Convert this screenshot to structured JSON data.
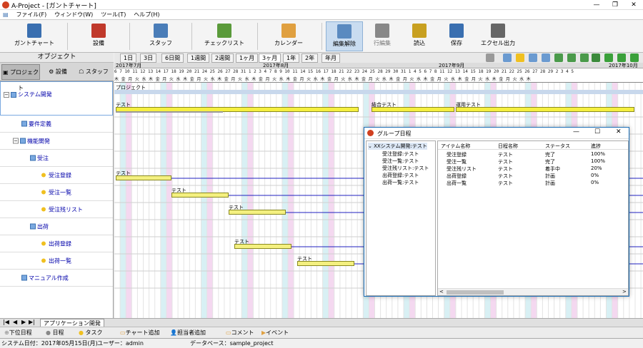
{
  "window": {
    "title": "A-Project - [ガントチャート]"
  },
  "menu": [
    "ファイル(F)",
    "ウィンドウ(W)",
    "ツール(T)",
    "ヘルプ(H)"
  ],
  "toolbar": [
    {
      "label": "ガントチャート",
      "icon": "gantt-icon",
      "color": "#3a6fb0"
    },
    {
      "label": "設備",
      "icon": "factory-icon",
      "color": "#c0392b"
    },
    {
      "label": "スタッフ",
      "icon": "staff-icon",
      "color": "#4a7db8"
    },
    {
      "label": "チェックリスト",
      "icon": "checklist-icon",
      "color": "#5a9a3a"
    },
    {
      "label": "カレンダー",
      "icon": "calendar-icon",
      "color": "#e0a040"
    },
    {
      "label": "編集解除",
      "icon": "edit-icon",
      "color": "#5a8ac0"
    },
    {
      "label": "行編集",
      "icon": "row-edit-icon",
      "color": "#888888"
    },
    {
      "label": "読込",
      "icon": "load-icon",
      "color": "#c8a020"
    },
    {
      "label": "保存",
      "icon": "save-icon",
      "color": "#3a6fb0"
    },
    {
      "label": "エクセル出力",
      "icon": "printer-icon",
      "color": "#666666"
    }
  ],
  "left": {
    "header": "オブジェクト",
    "tabs": [
      "プロジェクト",
      "設備",
      "スタッフ"
    ],
    "tree": [
      {
        "label": "システム開発",
        "kind": "group",
        "pm": "−"
      },
      {
        "label": "要件定義",
        "kind": "item"
      },
      {
        "label": "機能開発",
        "kind": "group",
        "pm": "−"
      },
      {
        "label": "受注",
        "kind": "item"
      },
      {
        "label": "受注登録",
        "kind": "task"
      },
      {
        "label": "受注一覧",
        "kind": "task"
      },
      {
        "label": "受注残リスト",
        "kind": "task"
      },
      {
        "label": "出荷",
        "kind": "item"
      },
      {
        "label": "出荷登録",
        "kind": "task"
      },
      {
        "label": "出荷一覧",
        "kind": "task"
      },
      {
        "label": "マニュアル作成",
        "kind": "item"
      }
    ]
  },
  "scale_tabs": [
    "1日",
    "3日",
    "6日間",
    "1週間",
    "2週間",
    "1ヶ月",
    "3ヶ月",
    "1年",
    "2年",
    "年月"
  ],
  "scale_selected": "3ヶ月",
  "date_header": {
    "months": [
      "2017年7月",
      "2017年8月",
      "2017年9月",
      "2017年10月"
    ],
    "days_row1": "6 7   10 11 12 13 14   17 18 19 20 21   24 25 26 27 28   31 1 2 3 4   7 8 9 10 11   14 15 16 17 18   21 22 23 24 25   28 29 30 31 1   4 5 6 7 8   11 12 13 14 15   18 19 20 21 22   25 26 27 28 29   2 3 4 5",
    "days_row2": "木 金   月 火 水 木 金   月 火 水 木 金   月 火 水 木 金   月 火 水 木 金   月 火 水 木 金   月 火 水 木 金   月 火 水 木 金   月 火 水 木 金   月 火 水 木 金   月 火 水 木 金   月 火 水 木 金   月 火 水 木"
  },
  "gantt": {
    "project_label": "プロジェクト",
    "bar_labels": [
      "テスト",
      "結合テスト",
      "運用テスト",
      "テスト",
      "テスト",
      "テスト",
      "テスト",
      "テスト"
    ]
  },
  "dialog": {
    "title": "グループ日程",
    "tree_root": "XXシステム開発:テスト",
    "tree_items": [
      "受注登録:テスト",
      "受注一覧:テスト",
      "受注残リスト:テスト",
      "出荷登録:テスト",
      "出荷一覧:テスト"
    ],
    "columns": [
      "アイテム名称",
      "日程名称",
      "ステータス",
      "進捗"
    ],
    "rows": [
      [
        "受注登録",
        "テスト",
        "完了",
        "100%"
      ],
      [
        "受注一覧",
        "テスト",
        "完了",
        "100%"
      ],
      [
        "受注残リスト",
        "テスト",
        "着手中",
        "20%"
      ],
      [
        "出荷登録",
        "テスト",
        "計画",
        "0%"
      ],
      [
        "出荷一覧",
        "テスト",
        "計画",
        "0%"
      ]
    ]
  },
  "sheet_tab": "アプリケーション開発",
  "actions": [
    "下位日程",
    "日程",
    "タスク",
    "チャート追加",
    "担当者追加",
    "コメント",
    "イベント"
  ],
  "status": {
    "date": "システム日付：2017年05月15日(月)",
    "user": "ユーザー：admin",
    "db": "データベース：sample_project"
  }
}
